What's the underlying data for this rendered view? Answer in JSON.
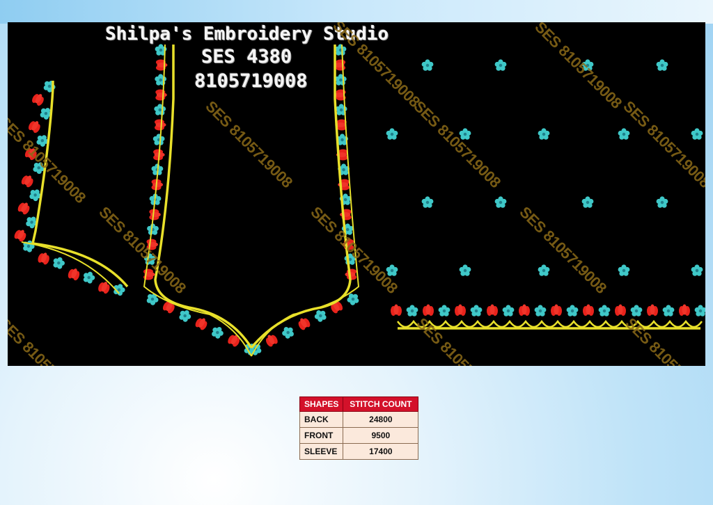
{
  "header": {
    "studio_name": "Shilpa's Embroidery Studio",
    "design_code": "SES 4380",
    "phone": "8105719008"
  },
  "watermark_text": "SES 8105719008",
  "colors": {
    "background_fabric": "#000000",
    "outline_thread": "#e8e02a",
    "flower_thread": "#3fc8c8",
    "petal_thread": "#e8231c",
    "table_header": "#d3112a",
    "table_cell": "#fbe9dc"
  },
  "stitch_table": {
    "headers": [
      "SHAPES",
      "STITCH COUNT"
    ],
    "rows": [
      {
        "shape": "BACK",
        "count": "24800"
      },
      {
        "shape": "FRONT",
        "count": "9500"
      },
      {
        "shape": "SLEEVE",
        "count": "17400"
      }
    ]
  }
}
